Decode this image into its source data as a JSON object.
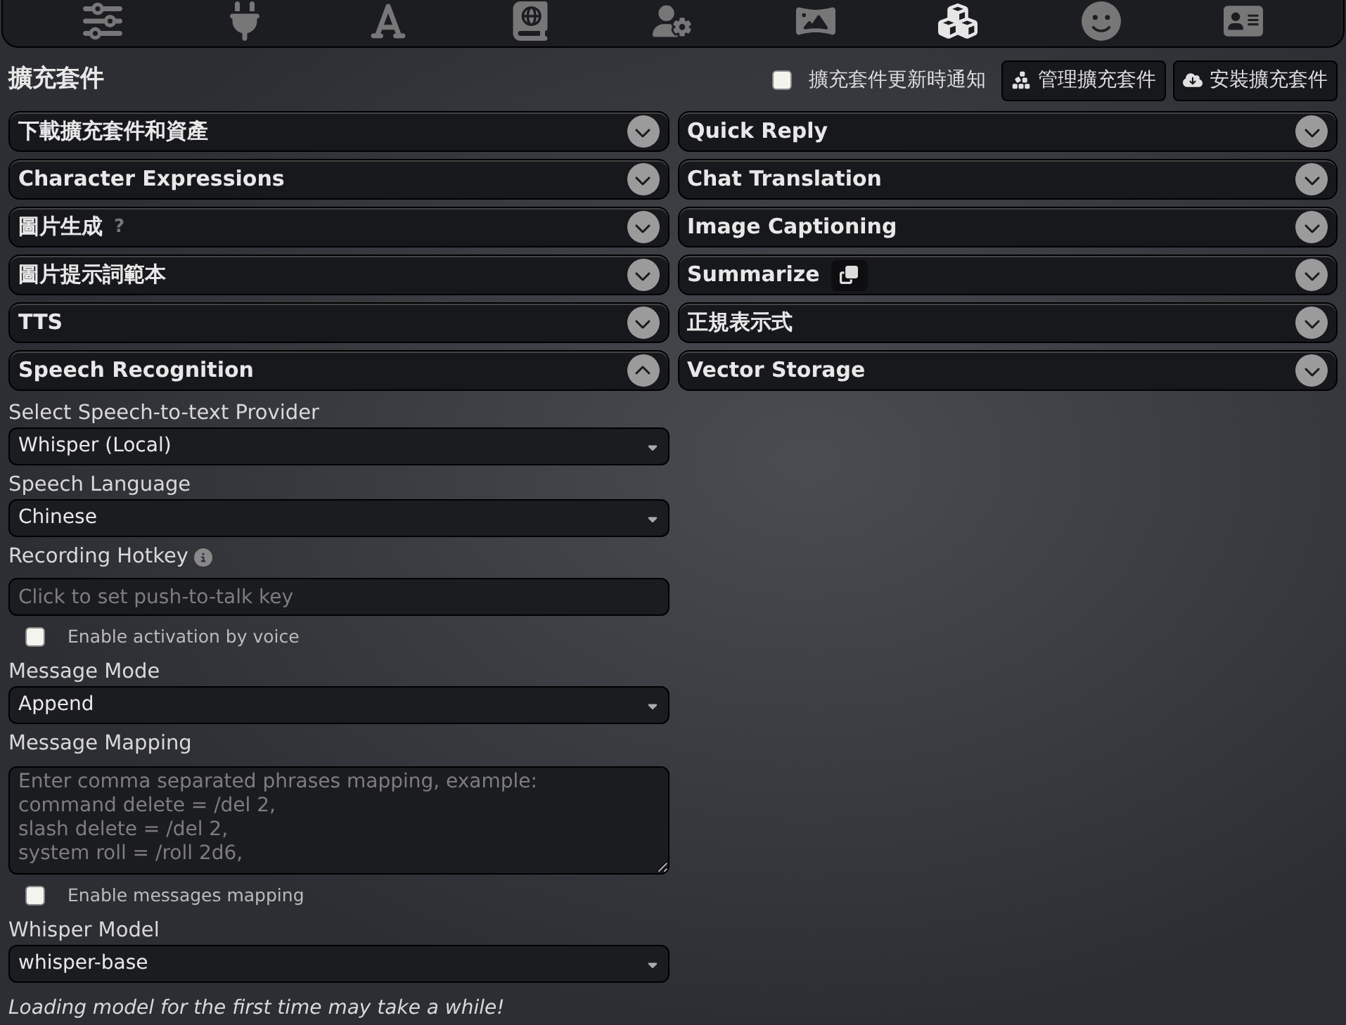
{
  "top_nav": [
    {
      "kind": "sliders",
      "selected": false
    },
    {
      "kind": "plug",
      "selected": false
    },
    {
      "kind": "font",
      "selected": false
    },
    {
      "kind": "book",
      "selected": false
    },
    {
      "kind": "user-gear",
      "selected": false
    },
    {
      "kind": "panorama",
      "selected": false
    },
    {
      "kind": "cubes",
      "selected": true
    },
    {
      "kind": "smile",
      "selected": false
    },
    {
      "kind": "card",
      "selected": false
    }
  ],
  "panel": {
    "title": "擴充套件",
    "notify": {
      "label": "擴充套件更新時通知",
      "checked": false
    },
    "buttons": [
      {
        "kind": "manage",
        "label": "管理擴充套件"
      },
      {
        "kind": "install",
        "label": "安裝擴充套件"
      }
    ]
  },
  "left_drawers": [
    {
      "title": "下載擴充套件和資產",
      "expanded": false
    },
    {
      "title": "Character Expressions",
      "expanded": false
    },
    {
      "title": "圖片生成",
      "hint": "?",
      "expanded": false
    },
    {
      "title": "圖片提示詞範本",
      "expanded": false
    },
    {
      "title": "TTS",
      "expanded": false
    },
    {
      "title": "Speech Recognition",
      "expanded": true
    }
  ],
  "right_drawers": [
    {
      "title": "Quick Reply",
      "expanded": false
    },
    {
      "title": "Chat Translation",
      "expanded": false
    },
    {
      "title": "Image Captioning",
      "expanded": false
    },
    {
      "title": "Summarize",
      "icon_button": true,
      "expanded": false
    },
    {
      "title": "正規表示式",
      "expanded": false
    },
    {
      "title": "Vector Storage",
      "expanded": false
    }
  ],
  "speech_form": [
    {
      "kind": "select",
      "label": "Select Speech-to-text Provider",
      "value": "Whisper (Local)"
    },
    {
      "kind": "select",
      "label": "Speech Language",
      "value": "Chinese"
    },
    {
      "kind": "input",
      "label": "Recording Hotkey",
      "info": true,
      "placeholder": "Click to set push-to-talk key"
    },
    {
      "kind": "checkbox",
      "label": "Enable activation by voice",
      "checked": false
    },
    {
      "kind": "select",
      "label": "Message Mode",
      "value": "Append"
    },
    {
      "kind": "textarea",
      "label": "Message Mapping",
      "placeholder": "Enter comma separated phrases mapping, example:\ncommand delete = /del 2,\nslash delete = /del 2,\nsystem roll = /roll 2d6,"
    },
    {
      "kind": "checkbox",
      "label": "Enable messages mapping",
      "checked": false
    },
    {
      "kind": "select",
      "label": "Whisper Model",
      "value": "whisper-base"
    },
    {
      "kind": "note",
      "text": "Loading model for the first time may take a while!"
    }
  ]
}
